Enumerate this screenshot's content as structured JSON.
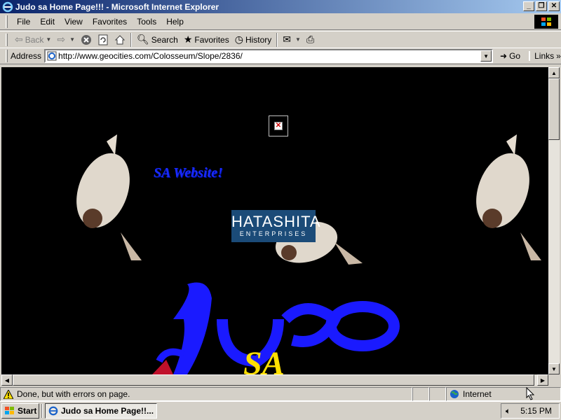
{
  "window": {
    "title": "Judo sa Home Page!!! - Microsoft Internet Explorer"
  },
  "menu": {
    "items": [
      "File",
      "Edit",
      "View",
      "Favorites",
      "Tools",
      "Help"
    ]
  },
  "toolbar": {
    "back": "Back",
    "search": "Search",
    "favorites": "Favorites",
    "history": "History"
  },
  "address": {
    "label": "Address",
    "url": "http://www.geocities.com/Colosseum/Slope/2836/",
    "go": "Go",
    "links": "Links"
  },
  "page": {
    "banner": "SA Website!",
    "sponsor_line1": "HATASHITA",
    "sponsor_line2": "ENTERPRISES",
    "big_title": "Judo",
    "big_sub": "SA"
  },
  "status": {
    "text": "Done, but with errors on page.",
    "zone": "Internet"
  },
  "taskbar": {
    "start": "Start",
    "task": "Judo sa Home Page!!...",
    "clock": "5:15 PM"
  },
  "colors": {
    "title_gradient_start": "#0a246a",
    "title_gradient_end": "#a6caf0",
    "chrome": "#d4d0c8",
    "page_bg": "#000000",
    "banner_text": "#1a2bff",
    "logo_bg": "#1b4b78",
    "big_title": "#1a1aff",
    "big_sub": "#ffe000"
  }
}
